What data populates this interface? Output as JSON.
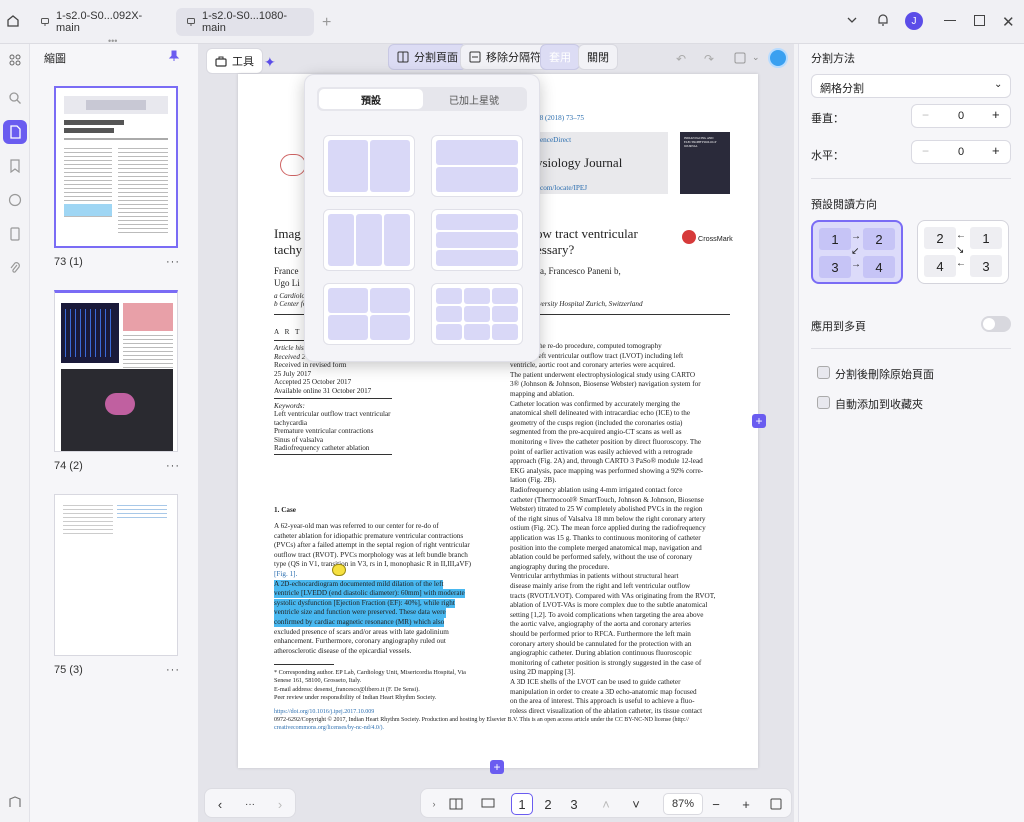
{
  "tabs": [
    {
      "label": "1-s2.0-S0...092X-main"
    },
    {
      "label": "1-s2.0-S0...1080-main"
    }
  ],
  "window": {
    "avatar": "J"
  },
  "thumbs": {
    "title": "縮圖",
    "pages": [
      {
        "label": "73 (1)"
      },
      {
        "label": "74 (2)"
      },
      {
        "label": "75 (3)"
      }
    ],
    "more": "···",
    "drag": "•••"
  },
  "toolbar": {
    "tools": "工具",
    "split": "分割頁面",
    "remove": "移除分隔符",
    "apply": "套用",
    "close": "關閉"
  },
  "popup": {
    "tab_preset": "預設",
    "tab_starred": "已加上星號"
  },
  "doc": {
    "journal_ref": "18 (2018) 73–75",
    "sciencedirect": "ienceDirect",
    "journal_name": "ysiology Journal",
    "journal_url": "com/locate/IPEJ",
    "cover_text": "INDIAN PACING AND ELECTROPHYSIOLOGY JOURNAL",
    "title1": "Imag",
    "title2": "tachy",
    "title1b": "ow tract ventricular",
    "title2b": "essary?",
    "crossmark": "CrossMark",
    "auth1": "France",
    "auth1b": "a, Francesco Paneni b,",
    "auth2": "Ugo Li",
    "aff1": "a Cardiolog",
    "aff2": "b Center fo",
    "aff2b": "logy, University Hospital Zurich, Switzerland",
    "artinfo": "A R T I",
    "hist": [
      "Article hist",
      "Received 2",
      "Received in revised form",
      "25 July 2017",
      "Accepted 25 October 2017",
      "Available online 31 October 2017"
    ],
    "kw_title": "Keywords:",
    "keywords": [
      "Left ventricular outflow tract ventricular",
      "tachycardia",
      "Premature ventricular contractions",
      "Sinus of valsalva",
      "Radiofrequency catheter ablation"
    ],
    "case": "1.  Case",
    "left_lines": [
      "A 62-year-old man was referred to our center for re-do of",
      "catheter ablation for idiopathic premature ventricular contractions",
      "(PVCs) after a failed attempt in the septal region of right ventricular",
      "outflow tract (RVOT). PVCs morphology was at left bundle branch",
      "type (QS in V1, transition in V3, rs in I, monophasic R in II,III,aVF)",
      "[Fig. 1].",
      "A 2D-echocardiogram documented mild dilation of the left",
      "ventricle [LVEDD (end diastolic diameter): 60mm] with moderate",
      "systolic dysfunction [Ejection Fraction (EF): 40%], while right",
      "ventricle size and function were preserved. These data were",
      "confirmed by cardiac magnetic resonance (MR) which also",
      "excluded presence of scars and/or areas with late gadolinium",
      "enhancement. Furthermore, coronary angiography ruled out",
      "atherosclerotic disease of the epicardial vessels."
    ],
    "right_lines": [
      "planning the re-do procedure, computed tomography",
      "ns of the left ventricular outflow tract (LVOT) including left",
      "ventricle, aortic root and coronary arteries were acquired.",
      "The patient underwent electrophysiological study using CARTO",
      "3® (Johnson & Johnson, Biosense Webster) navigation system for",
      "mapping and ablation.",
      "Catheter location was confirmed by accurately merging the",
      "anatomical shell delineated with intracardiac echo (ICE) to the",
      "geometry of the cusps region (included the coronaries ostia)",
      "segmented from the pre-acquired angio-CT scans as well as",
      "monitoring « live» the catheter position by direct fluoroscopy. The",
      "point of earlier activation was easily achieved with a retrograde",
      "approach (Fig. 2A) and, through CARTO 3 PaSo® module 12-lead",
      "EKG analysis, pace mapping was performed showing a 92% corre-",
      "lation (Fig. 2B).",
      "Radiofrequency ablation using 4-mm irrigated contact force",
      "catheter (Thermocool® SmartTouch, Johnson & Johnson, Biosense",
      "Webster) titrated to 25 W completely abolished PVCs in the region",
      "of the right sinus of Valsalva 18 mm below the right coronary artery",
      "ostium (Fig. 2C). The mean force applied during the radiofrequency",
      "application was 15 g. Thanks to continuous monitoring of catheter",
      "position into the complete merged anatomical map, navigation and",
      "ablation could be performed safely, without the use of coronary",
      "angiography during the procedure.",
      "Ventricular arrhythmias in patients without structural heart",
      "disease mainly arise from the right and left ventricular outflow",
      "tracts (RVOT/LVOT). Compared with VAs originating from the RVOT,",
      "ablation of LVOT-VAs is more complex due to the subtle anatomical",
      "setting [1,2]. To avoid complications when targeting the area above",
      "the aortic valve, angiography of the aorta and coronary arteries",
      "should be performed prior to RFCA. Furthermore the left main",
      "coronary artery should be cannulated for the protection with an",
      "angiographic catheter. During ablation continuous fluoroscopic",
      "monitoring of catheter position is strongly suggested in the case of",
      "using 2D mapping [3].",
      "A 3D ICE shells of the LVOT can be used to guide catheter",
      "manipulation in order to create a 3D echo-anatomic map focused",
      "on the area of interest. This approach is useful to achieve a fluo-",
      "roless direct visualization of the ablation catheter, its tissue contact"
    ],
    "foot": [
      "* Corresponding author. EP Lab, Cardiology Unit, Misericordia Hospital, Via",
      "Senese 161, 58100, Grosseto, Italy.",
      "E-mail address: desensi_francesco@libero.it (F. De Sensi).",
      "Peer review under responsibility of Indian Heart Rhythm Society."
    ],
    "doi": "https://doi.org/10.1016/j.ipej.2017.10.009",
    "copyright": "0972-6292/Copyright © 2017, Indian Heart Rhythm Society. Production and hosting by Elsevier B.V. This is an open access article under the CC BY-NC-ND license (http://",
    "copyright2": "creativecommons.org/licenses/by-nc-nd/4.0/)."
  },
  "bottom": {
    "pages": [
      "1",
      "2",
      "3"
    ],
    "zoom": "87%",
    "more": "···"
  },
  "right": {
    "method_title": "分割方法",
    "method_value": "網格分割",
    "vertical_label": "垂直：",
    "vertical_value": "0",
    "horizontal_label": "水平：",
    "horizontal_value": "0",
    "dir_title": "預設閱讀方向",
    "dir1": [
      "1",
      "2",
      "3",
      "4"
    ],
    "dir2": [
      "2",
      "1",
      "4",
      "3"
    ],
    "apply_multi": "應用到多頁",
    "opt1": "分割後刪除原始頁面",
    "opt2": "自動添加到收藏夾"
  },
  "colors": {
    "accent": "#6a5cf0",
    "highlight": "#49b8f0"
  }
}
